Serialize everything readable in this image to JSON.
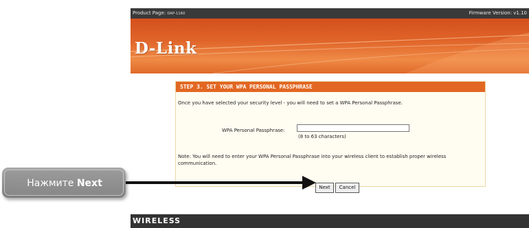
{
  "topbar": {
    "product_prefix": "Product Page: ",
    "product_model": "DAP-1160",
    "firmware": "Firmware Version: v1.10"
  },
  "banner": {
    "logo": "D-Link"
  },
  "wizard": {
    "title": "STEP 3. SET YOUR WPA PERSONAL PASSPHRASE",
    "intro": "Once you have selected your security level - you will need to set a WPA Personal Passphrase.",
    "passphrase_label": "WPA Personal Passphrase:",
    "passphrase_value": "",
    "passphrase_hint": "(8 to 63 characters)",
    "note": "Note: You will need to enter your WPA Personal Passphrase into your wireless client to establish proper wireless communication.",
    "next_label": "Next",
    "cancel_label": "Cancel"
  },
  "footer": {
    "label": "WIRELESS"
  },
  "callout": {
    "text_prefix": "Нажмите ",
    "text_bold": "Next"
  },
  "colors": {
    "accent": "#e26722",
    "topbar": "#3a3a3a",
    "panel_bg": "#fffdf2"
  }
}
